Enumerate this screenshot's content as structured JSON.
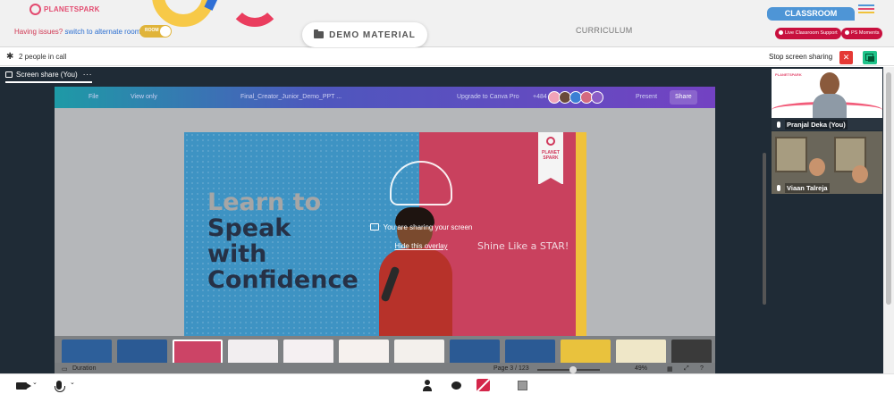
{
  "header": {
    "logo_text": "PLANETSPARK",
    "issue_text": "Having issues?",
    "issue_link": "switch to alternate room",
    "toggle_label": "ROOM",
    "demo_material": "DEMO MATERIAL",
    "curriculum": "CURRICULUM",
    "classroom_tab": "CLASSROOM",
    "live_support": "Live Classroom Support",
    "ps_moments": "PS Moments"
  },
  "callbar": {
    "people": "2 people in call",
    "stop_sharing": "Stop screen sharing"
  },
  "stage": {
    "tab_label": "Screen share (You)",
    "tab_more": "···",
    "editor": {
      "menu_file": "File",
      "view_only": "View only",
      "doc_title": "Final_Creator_Junior_Demo_PPT ...",
      "upgrade": "Upgrade to Canva Pro",
      "collab_count": "+484",
      "present": "Present",
      "share": "Share",
      "duration": "Duration",
      "page": "Page 3 / 123",
      "zoom": "49%"
    },
    "slide": {
      "line1": "Learn to",
      "line2": "Speak",
      "line3": "with",
      "line4": "Confidence",
      "shine": "Shine Like a STAR!",
      "badge": "PLANET SPARK"
    },
    "overlay": {
      "message": "You are sharing your screen",
      "hide": "Hide this overlay"
    }
  },
  "participants": [
    {
      "name": "Pranjal Deka (You)"
    },
    {
      "name": "Viaan Talreja"
    }
  ],
  "colors": {
    "accent_red": "#c8103e",
    "classroom_blue": "#4e95d6",
    "stage_bg": "#1f2b36",
    "share_green": "#1fc38a"
  },
  "icons": {
    "settings": "gear-icon",
    "camera": "camera-icon",
    "mic": "microphone-icon",
    "participants": "person-icon",
    "chat": "chat-icon",
    "screen": "stop-screen-share-icon",
    "whiteboard": "square-icon"
  }
}
